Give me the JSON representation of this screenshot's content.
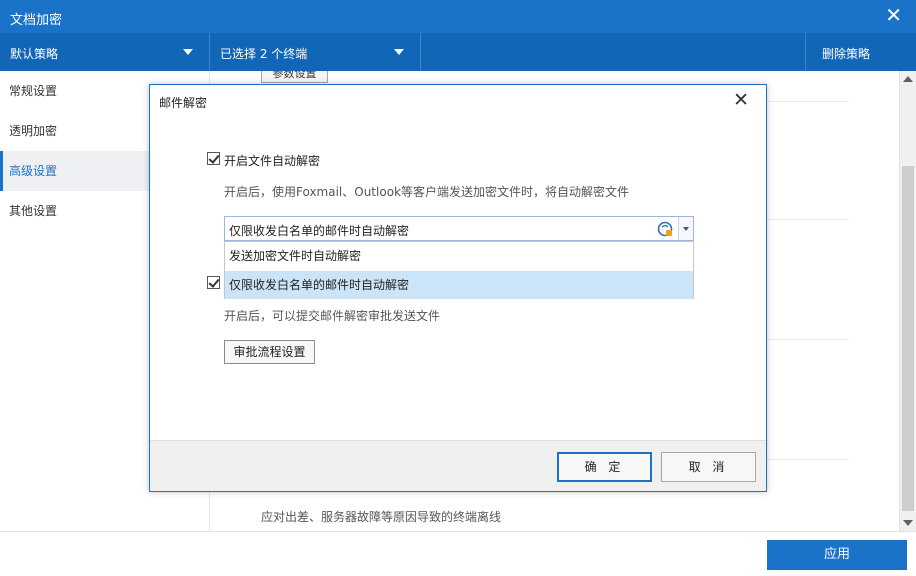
{
  "window": {
    "title": "文档加密",
    "close_glyph": "✕"
  },
  "toolbar": {
    "policy_select": "默认策略",
    "terminal_select": "已选择 2 个终端",
    "delete_policy": "删除策略"
  },
  "sidebar": {
    "items": [
      {
        "label": "常规设置"
      },
      {
        "label": "透明加密"
      },
      {
        "label": "高级设置"
      },
      {
        "label": "其他设置"
      }
    ],
    "active": "高级设置"
  },
  "main": {
    "param_button": "参数设置",
    "offline_desc": "应对出差、服务器故障等原因导致的终端离线"
  },
  "footer": {
    "apply": "应用"
  },
  "modal": {
    "title": "邮件解密",
    "close_glyph": "✕",
    "auto_decrypt": {
      "label": "开启文件自动解密",
      "desc": "开启后，使用Foxmail、Outlook等客户端发送加密文件时，将自动解密文件",
      "combo_value": "仅限收发白名单的邮件时自动解密",
      "options": [
        {
          "label": "发送加密文件时自动解密"
        },
        {
          "label": "仅限收发白名单的邮件时自动解密"
        }
      ]
    },
    "approval": {
      "desc": "开启后，可以提交邮件解密审批发送文件",
      "button": "审批流程设置"
    },
    "ok": "确 定",
    "cancel": "取 消"
  },
  "colors": {
    "accent": "#1a73c8",
    "toolbar": "#1266b8",
    "selected_option": "#cce4f7"
  }
}
